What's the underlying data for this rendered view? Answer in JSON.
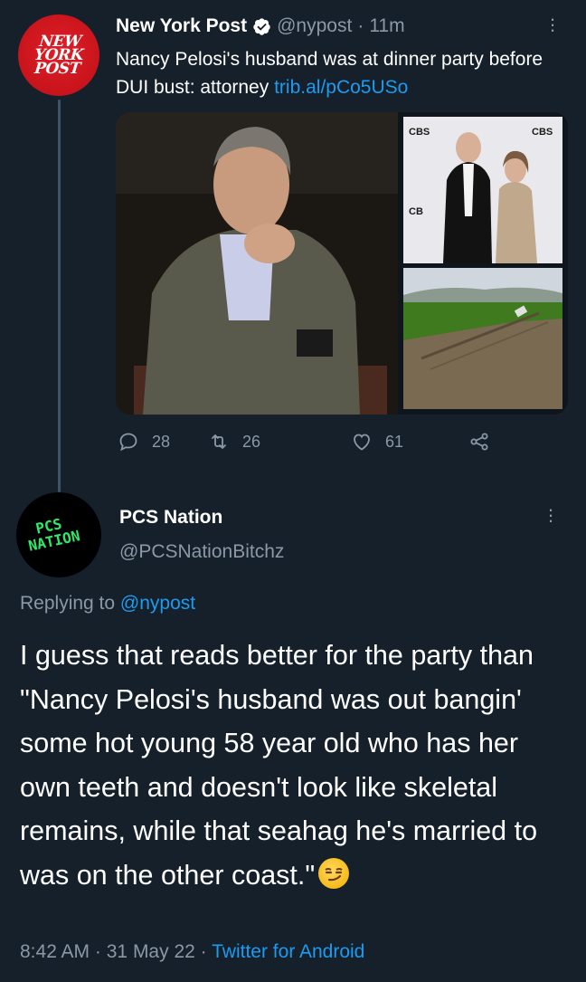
{
  "tweet_main": {
    "author_name": "New York Post",
    "handle": "@nypost",
    "separator": "·",
    "time": "11m",
    "avatar_text": [
      "NEW",
      "YORK",
      "POST"
    ],
    "text": "Nancy Pelosi's husband was at dinner party before DUI bust: attorney",
    "link": "trib.al/pCo5USo",
    "stats": {
      "replies": "28",
      "retweets": "26",
      "likes": "61"
    }
  },
  "tweet_reply": {
    "author_name": "PCS Nation",
    "handle": "@PCSNationBitchz",
    "avatar_text": [
      "PCS",
      "NATION"
    ],
    "replying_label": "Replying to",
    "replying_handle": "@nypost",
    "text": "I guess that reads better for the party than \"Nancy Pelosi's husband was out bangin' some hot young 58 year old who has her own teeth and doesn't look like skeletal remains, while that seahag he's married to was on the other coast.\"",
    "emoji": "smirking-face",
    "time": "8:42 AM",
    "date": "31 May 22",
    "meta_separator": "·",
    "source": "Twitter for Android"
  },
  "media": {
    "photo_tr_badges": [
      "CBS",
      "CBS",
      "CB"
    ]
  },
  "colors": {
    "background": "#15202b",
    "text": "#ffffff",
    "muted": "#8b98a5",
    "link": "#1d9bf0",
    "nypost_red": "#e01e27",
    "pcs_green": "#2ee86a"
  },
  "icons": [
    "more-icon",
    "verified-icon",
    "reply-icon",
    "retweet-icon",
    "like-icon",
    "share-icon"
  ]
}
